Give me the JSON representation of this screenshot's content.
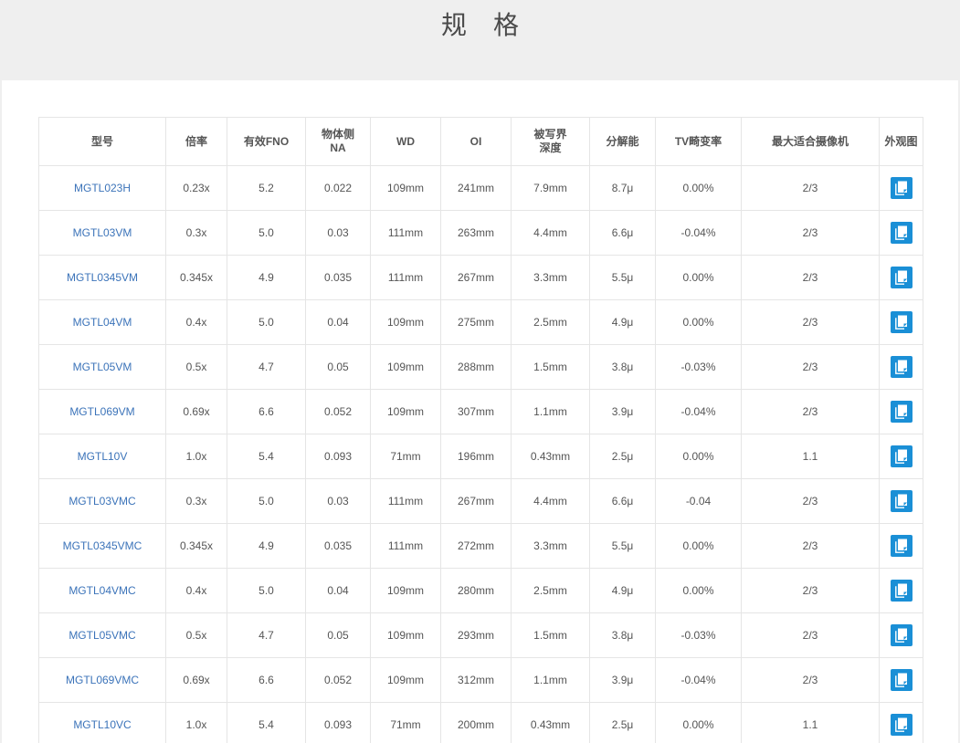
{
  "page": {
    "title": "规 格"
  },
  "table": {
    "headers": [
      "型号",
      "倍率",
      "有效FNO",
      "物体侧\nNA",
      "WD",
      "OI",
      "被写界\n深度",
      "分解能",
      "TV畸变率",
      "最大适合摄像机",
      "外观图"
    ],
    "rows": [
      [
        "MGTL023H",
        "0.23x",
        "5.2",
        "0.022",
        "109mm",
        "241mm",
        "7.9mm",
        "8.7μ",
        "0.00%",
        "2/3"
      ],
      [
        "MGTL03VM",
        "0.3x",
        "5.0",
        "0.03",
        "111mm",
        "263mm",
        "4.4mm",
        "6.6μ",
        "-0.04%",
        "2/3"
      ],
      [
        "MGTL0345VM",
        "0.345x",
        "4.9",
        "0.035",
        "111mm",
        "267mm",
        "3.3mm",
        "5.5μ",
        "0.00%",
        "2/3"
      ],
      [
        "MGTL04VM",
        "0.4x",
        "5.0",
        "0.04",
        "109mm",
        "275mm",
        "2.5mm",
        "4.9μ",
        "0.00%",
        "2/3"
      ],
      [
        "MGTL05VM",
        "0.5x",
        "4.7",
        "0.05",
        "109mm",
        "288mm",
        "1.5mm",
        "3.8μ",
        "-0.03%",
        "2/3"
      ],
      [
        "MGTL069VM",
        "0.69x",
        "6.6",
        "0.052",
        "109mm",
        "307mm",
        "1.1mm",
        "3.9μ",
        "-0.04%",
        "2/3"
      ],
      [
        "MGTL10V",
        "1.0x",
        "5.4",
        "0.093",
        "71mm",
        "196mm",
        "0.43mm",
        "2.5μ",
        "0.00%",
        "1.1"
      ],
      [
        "MGTL03VMC",
        "0.3x",
        "5.0",
        "0.03",
        "111mm",
        "267mm",
        "4.4mm",
        "6.6μ",
        "-0.04",
        "2/3"
      ],
      [
        "MGTL0345VMC",
        "0.345x",
        "4.9",
        "0.035",
        "111mm",
        "272mm",
        "3.3mm",
        "5.5μ",
        "0.00%",
        "2/3"
      ],
      [
        "MGTL04VMC",
        "0.4x",
        "5.0",
        "0.04",
        "109mm",
        "280mm",
        "2.5mm",
        "4.9μ",
        "0.00%",
        "2/3"
      ],
      [
        "MGTL05VMC",
        "0.5x",
        "4.7",
        "0.05",
        "109mm",
        "293mm",
        "1.5mm",
        "3.8μ",
        "-0.03%",
        "2/3"
      ],
      [
        "MGTL069VMC",
        "0.69x",
        "6.6",
        "0.052",
        "109mm",
        "312mm",
        "1.1mm",
        "3.9μ",
        "-0.04%",
        "2/3"
      ],
      [
        "MGTL10VC",
        "1.0x",
        "5.4",
        "0.093",
        "71mm",
        "200mm",
        "0.43mm",
        "2.5μ",
        "0.00%",
        "1.1"
      ]
    ],
    "view_icon": "document-icon"
  },
  "colors": {
    "title_band": "#efefef",
    "model_link": "#3b73b9",
    "view_button": "#1a8fd6",
    "border": "#e5e5e5",
    "text": "#555555"
  }
}
